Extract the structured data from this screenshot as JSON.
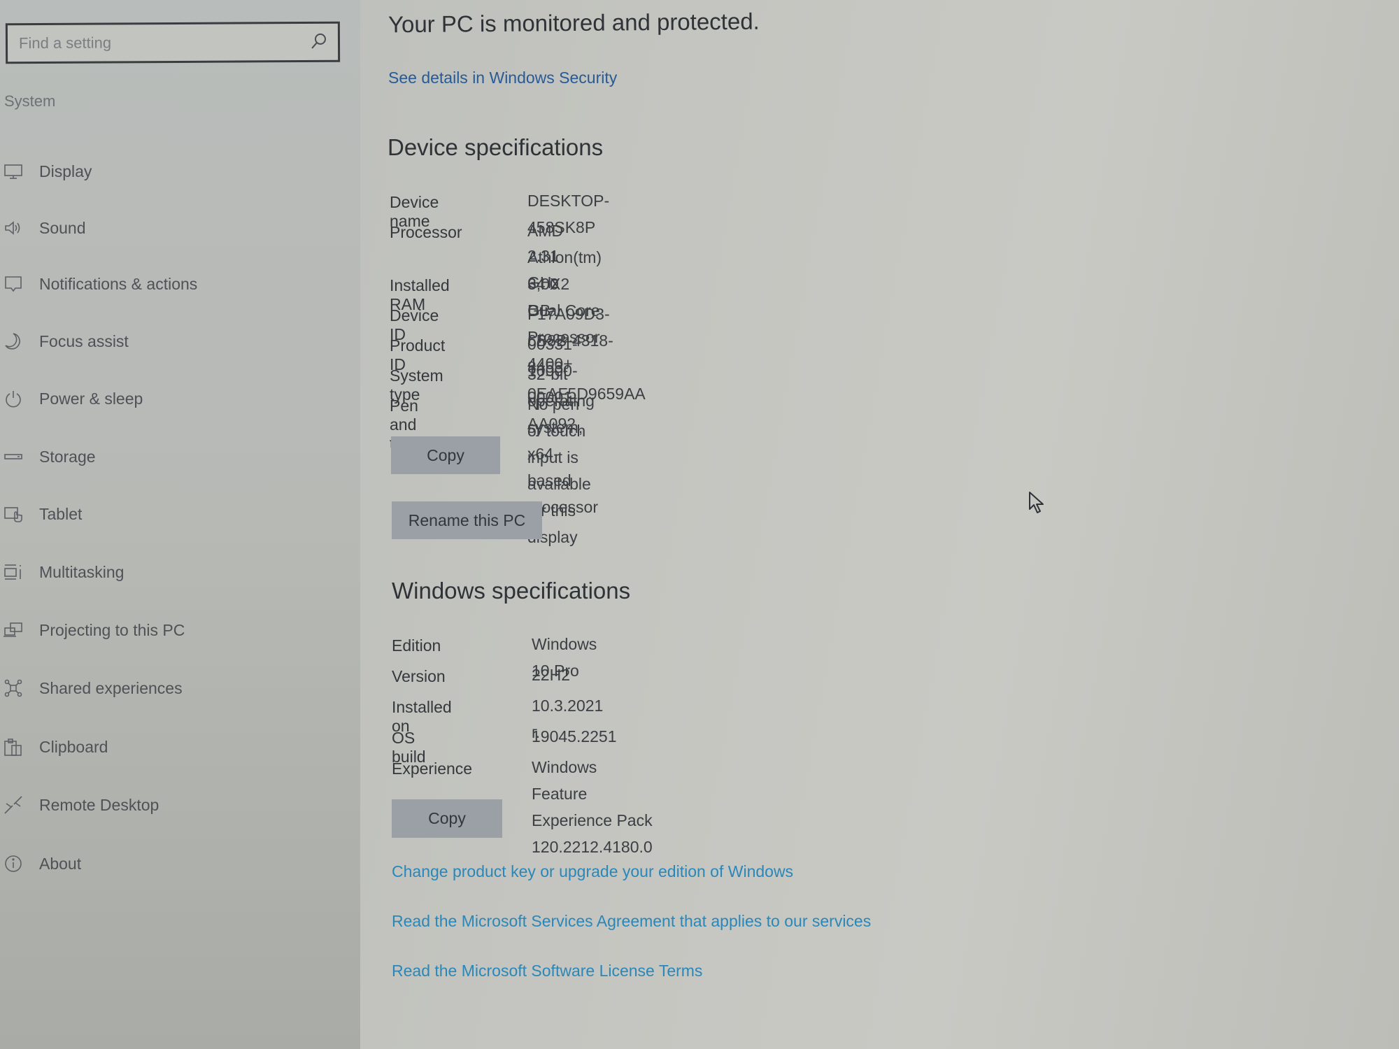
{
  "sidebar": {
    "search_placeholder": "Find a setting",
    "section": "System",
    "items": [
      {
        "label": "Display",
        "icon": "monitor-icon"
      },
      {
        "label": "Sound",
        "icon": "speaker-icon"
      },
      {
        "label": "Notifications & actions",
        "icon": "notification-icon"
      },
      {
        "label": "Focus assist",
        "icon": "moon-icon"
      },
      {
        "label": "Power & sleep",
        "icon": "power-icon"
      },
      {
        "label": "Storage",
        "icon": "storage-icon"
      },
      {
        "label": "Tablet",
        "icon": "tablet-icon"
      },
      {
        "label": "Multitasking",
        "icon": "multitasking-icon"
      },
      {
        "label": "Projecting to this PC",
        "icon": "projecting-icon"
      },
      {
        "label": "Shared experiences",
        "icon": "shared-icon"
      },
      {
        "label": "Clipboard",
        "icon": "clipboard-icon"
      },
      {
        "label": "Remote Desktop",
        "icon": "remote-desktop-icon"
      },
      {
        "label": "About",
        "icon": "info-icon"
      }
    ]
  },
  "main": {
    "protection_title": "Your PC is monitored and protected.",
    "security_link": "See details in Windows Security",
    "device_specs": {
      "title": "Device specifications",
      "rows": [
        {
          "key": "Device name",
          "value": "DESKTOP-458SK8P"
        },
        {
          "key": "Processor",
          "value": "AMD Athlon(tm) 64 X2 Dual Core Processor 4400+",
          "value2": "2.31 GHz"
        },
        {
          "key": "Installed RAM",
          "value": "3,00 GB"
        },
        {
          "key": "Device ID",
          "value": "F17A09D3-6B8B-4318-8453-0EAF5D9659AA"
        },
        {
          "key": "Product ID",
          "value": "00331-10000-00001-AA092"
        },
        {
          "key": "System type",
          "value": "32-bit operating system, x64-based processor"
        },
        {
          "key": "Pen and touch",
          "value": "No pen or touch input is available for this display"
        }
      ],
      "copy_label": "Copy",
      "rename_label": "Rename this PC"
    },
    "windows_specs": {
      "title": "Windows specifications",
      "rows": [
        {
          "key": "Edition",
          "value": "Windows 10 Pro"
        },
        {
          "key": "Version",
          "value": "22H2"
        },
        {
          "key": "Installed on",
          "value": "10.3.2021 г."
        },
        {
          "key": "OS build",
          "value": "19045.2251"
        },
        {
          "key": "Experience",
          "value": "Windows Feature Experience Pack 120.2212.4180.0"
        }
      ],
      "copy_label": "Copy"
    },
    "links": [
      "Change product key or upgrade your edition of Windows",
      "Read the Microsoft Services Agreement that applies to our services",
      "Read the Microsoft Software License Terms"
    ]
  },
  "colors": {
    "link": "#2a87b8",
    "security_link": "#285a96",
    "button_bg": "#9aa0a6"
  }
}
